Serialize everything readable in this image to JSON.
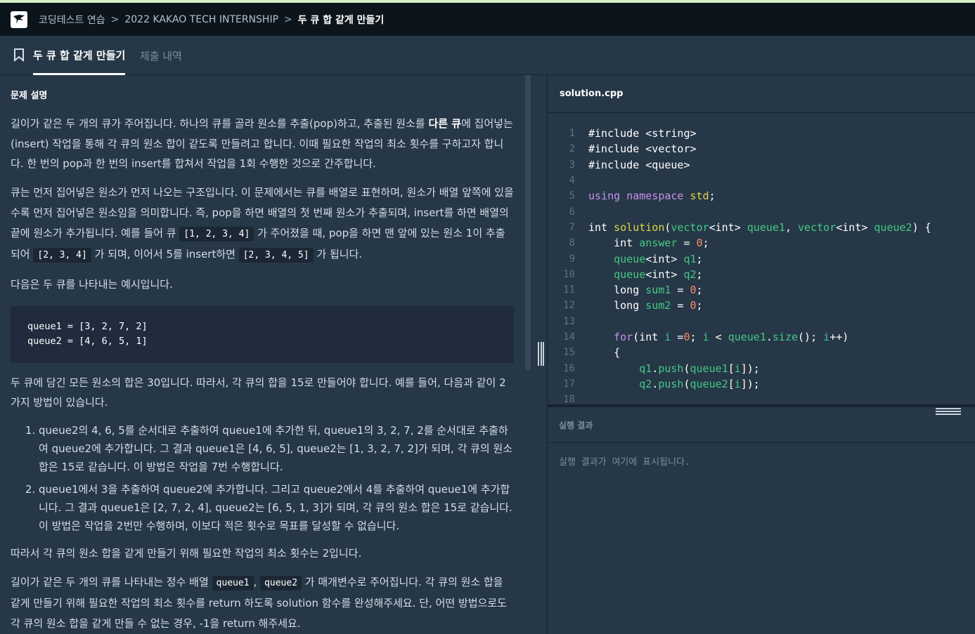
{
  "breadcrumb": {
    "items": [
      "코딩테스트 연습",
      "2022 KAKAO TECH INTERNSHIP",
      "두 큐 합 같게 만들기"
    ],
    "separator": ">"
  },
  "tabs": {
    "problem": "두 큐 합 같게 만들기",
    "submissions": "제출 내역"
  },
  "description": {
    "section_title": "문제 설명",
    "p1_a": "길이가 같은 두 개의 큐가 주어집니다. 하나의 큐를 골라 원소를 추출(pop)하고, 추출된 원소를 ",
    "p1_bold": "다른 큐",
    "p1_b": "에 집어넣는(insert) 작업을 통해 각 큐의 원소 합이 같도록 만들려고 합니다. 이때 필요한 작업의 최소 횟수를 구하고자 합니다. 한 번의 pop과 한 번의 insert를 합쳐서 작업을 1회 수행한 것으로 간주합니다.",
    "p2_a": "큐는 먼저 집어넣은 원소가 먼저 나오는 구조입니다. 이 문제에서는 큐를 배열로 표현하며, 원소가 배열 앞쪽에 있을수록 먼저 집어넣은 원소임을 의미합니다. 즉, pop을 하면 배열의 첫 번째 원소가 추출되며, insert를 하면 배열의 끝에 원소가 추가됩니다. 예를 들어 큐 ",
    "p2_code1": "[1, 2, 3, 4]",
    "p2_b": " 가 주어졌을 때, pop을 하면 맨 앞에 있는 원소 1이 추출되어 ",
    "p2_code2": "[2, 3, 4]",
    "p2_c": " 가 되며, 이어서 5를 insert하면 ",
    "p2_code3": "[2, 3, 4, 5]",
    "p2_d": " 가 됩니다.",
    "p3": "다음은 두 큐를 나타내는 예시입니다.",
    "code_lines": [
      "queue1 = [3, 2, 7, 2]",
      "queue2 = [4, 6, 5, 1]"
    ],
    "p4": "두 큐에 담긴 모든 원소의 합은 30입니다. 따라서, 각 큐의 합을 15로 만들어야 합니다. 예를 들어, 다음과 같이 2가지 방법이 있습니다.",
    "steps": [
      "queue2의 4, 6, 5를 순서대로 추출하여 queue1에 추가한 뒤, queue1의 3, 2, 7, 2를 순서대로 추출하여 queue2에 추가합니다. 그 결과 queue1은 [4, 6, 5], queue2는 [1, 3, 2, 7, 2]가 되며, 각 큐의 원소 합은 15로 같습니다. 이 방법은 작업을 7번 수행합니다.",
      "queue1에서 3을 추출하여 queue2에 추가합니다. 그리고 queue2에서 4를 추출하여 queue1에 추가합니다. 그 결과 queue1은 [2, 7, 2, 4], queue2는 [6, 5, 1, 3]가 되며, 각 큐의 원소 합은 15로 같습니다. 이 방법은 작업을 2번만 수행하며, 이보다 적은 횟수로 목표를 달성할 수 없습니다."
    ],
    "p5": "따라서 각 큐의 원소 합을 같게 만들기 위해 필요한 작업의 최소 횟수는 2입니다.",
    "p6_a": "길이가 같은 두 개의 큐를 나타내는 정수 배열 ",
    "p6_code1": "queue1",
    "p6_sep": ", ",
    "p6_code2": "queue2",
    "p6_b": " 가 매개변수로 주어집니다. 각 큐의 원소 합을 같게 만들기 위해 필요한 작업의 최소 횟수를 return 하도록 solution 함수를 완성해주세요. 단, 어떤 방법으로도 각 큐의 원소 합을 같게 만들 수 없는 경우, -1을 return 해주세요."
  },
  "editor": {
    "filename": "solution.cpp",
    "line_numbers": [
      "1",
      "2",
      "3",
      "4",
      "5",
      "6",
      "7",
      "8",
      "9",
      "10",
      "11",
      "12",
      "13",
      "14",
      "15",
      "16",
      "17",
      "18"
    ]
  },
  "result": {
    "title": "실행 결과",
    "placeholder": "실행 결과가 여기에 표시됩니다."
  },
  "colors": {
    "background": "#263747",
    "navbar": "#0c151c",
    "accent_top": "#d9f0c8"
  }
}
